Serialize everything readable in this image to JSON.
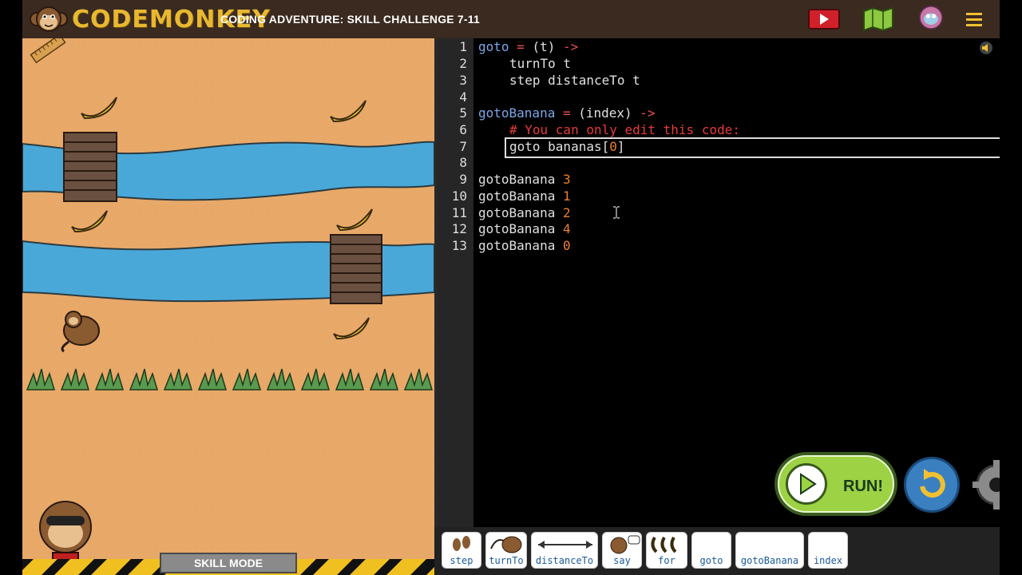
{
  "header": {
    "logo_text": "CODEMONKEY",
    "title": "CODING ADVENTURE: SKILL CHALLENGE 7-11",
    "icons": [
      "video-icon",
      "map-icon",
      "avatar-icon",
      "menu-icon"
    ]
  },
  "game": {
    "mode_label": "SKILL MODE"
  },
  "editor": {
    "line_numbers": [
      "1",
      "2",
      "3",
      "4",
      "5",
      "6",
      "7",
      "8",
      "9",
      "10",
      "11",
      "12",
      "13"
    ],
    "lines": [
      {
        "ln": "1"
      },
      {
        "ln": "2"
      },
      {
        "ln": "3"
      },
      {
        "ln": "4"
      },
      {
        "ln": "5"
      },
      {
        "ln": "6"
      },
      {
        "ln": "7"
      },
      {
        "ln": "8"
      },
      {
        "ln": "9"
      },
      {
        "ln": "10"
      },
      {
        "ln": "11"
      },
      {
        "ln": "12"
      },
      {
        "ln": "13"
      }
    ],
    "code": {
      "l1_name": "goto",
      "l1_eq": " = ",
      "l1_params": "(t)",
      "l1_arrow": " ->",
      "l2": "turnTo t",
      "l3": "step distanceTo t",
      "l5_name": "gotoBanana",
      "l5_eq": " = ",
      "l5_params": "(index)",
      "l5_arrow": " ->",
      "l6": "# You can only edit this code:",
      "l7_a": "goto bananas[",
      "l7_b": "0",
      "l7_c": "]",
      "calls": [
        {
          "fn": "gotoBanana",
          "arg": "3"
        },
        {
          "fn": "gotoBanana",
          "arg": "1"
        },
        {
          "fn": "gotoBanana",
          "arg": "2"
        },
        {
          "fn": "gotoBanana",
          "arg": "4"
        },
        {
          "fn": "gotoBanana",
          "arg": "0"
        }
      ]
    }
  },
  "controls": {
    "run_label": "RUN!"
  },
  "toolbar": {
    "items": [
      {
        "label": "step",
        "icon": "footprints-icon"
      },
      {
        "label": "turnTo",
        "icon": "turn-icon"
      },
      {
        "label": "distanceTo",
        "icon": "distance-arrow-icon"
      },
      {
        "label": "say",
        "icon": "monkey-speech-icon"
      },
      {
        "label": "for",
        "icon": "bananas-icon"
      },
      {
        "label": "goto",
        "icon": ""
      },
      {
        "label": "gotoBanana",
        "icon": ""
      },
      {
        "label": "index",
        "icon": ""
      }
    ]
  },
  "colors": {
    "header_bg": "#3a2a20",
    "logo": "#e8b830",
    "sand": "#e8a868",
    "river": "#4aa8d8",
    "run_green": "#9cd244",
    "reset_blue": "#3a80c0",
    "code_fn": "#7aa7e8",
    "code_num": "#f08030",
    "code_comment": "#e83a3a"
  }
}
